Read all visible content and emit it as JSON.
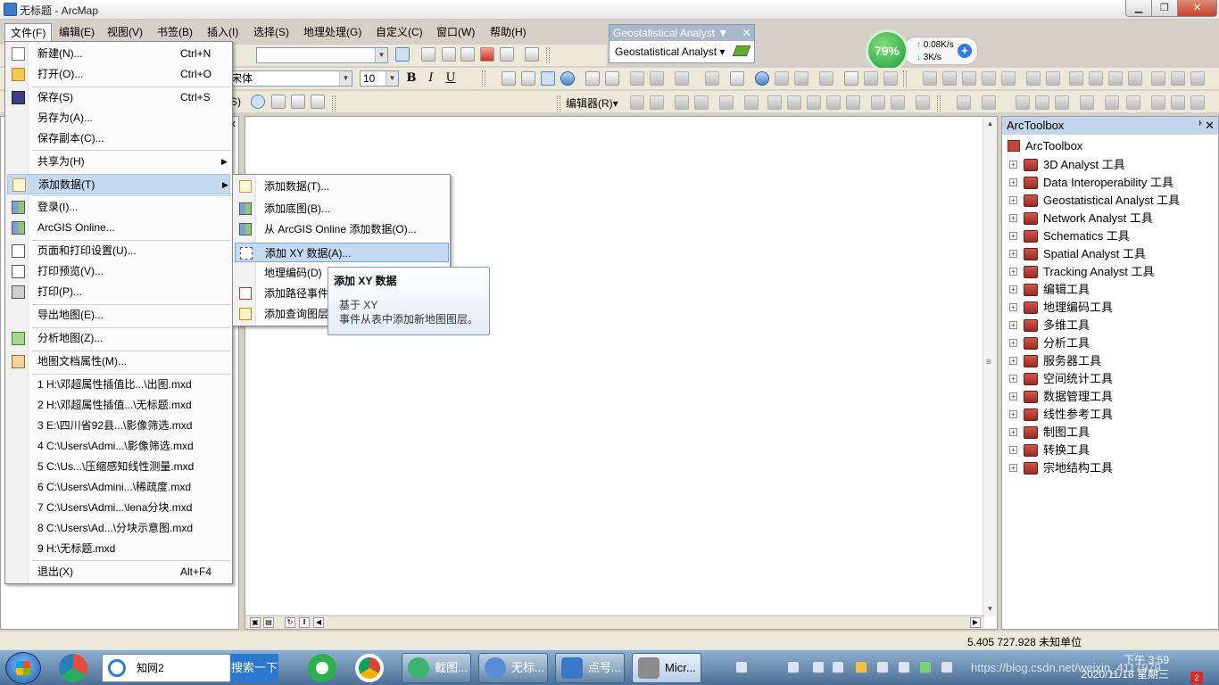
{
  "window": {
    "title": "无标题 - ArcMap"
  },
  "menubar": [
    {
      "id": "file",
      "label": "文件(F)"
    },
    {
      "id": "edit",
      "label": "编辑(E)"
    },
    {
      "id": "view",
      "label": "视图(V)"
    },
    {
      "id": "bookmarks",
      "label": "书签(B)"
    },
    {
      "id": "insert",
      "label": "插入(I)"
    },
    {
      "id": "selection",
      "label": "选择(S)"
    },
    {
      "id": "geoprocessing",
      "label": "地理处理(G)"
    },
    {
      "id": "customize",
      "label": "自定义(C)"
    },
    {
      "id": "windows",
      "label": "窗口(W)"
    },
    {
      "id": "help",
      "label": "帮助(H)"
    }
  ],
  "toolbar": {
    "font_name": "宋体",
    "font_size": "10",
    "bold": "B",
    "italic": "I",
    "underline": "U",
    "editor_label": "编辑器(R)▾",
    "selection_tail": "S)"
  },
  "geostat_toolbar": {
    "title": "Geostatistical Analyst ▼",
    "close": "✕",
    "dropdown": "Geostatistical Analyst ▾"
  },
  "net_speed": {
    "percent": "79%",
    "up": "0.08K/s",
    "down": "3K/s",
    "plus": "+"
  },
  "file_menu": {
    "items": [
      {
        "label": "新建(N)...",
        "shortcut": "Ctrl+N",
        "icon": "new-doc-icon"
      },
      {
        "label": "打开(O)...",
        "shortcut": "Ctrl+O",
        "icon": "open-folder-icon"
      },
      {
        "label": "保存(S)",
        "shortcut": "Ctrl+S",
        "icon": "save-disk-icon"
      },
      {
        "label": "另存为(A)...",
        "shortcut": ""
      },
      {
        "label": "保存副本(C)...",
        "shortcut": ""
      },
      {
        "label": "共享为(H)",
        "shortcut": "",
        "arrow": "▶"
      },
      {
        "label": "添加数据(T)",
        "shortcut": "",
        "arrow": "▶",
        "icon": "add-data-icon"
      },
      {
        "label": "登录(I)...",
        "shortcut": "",
        "icon": "sign-in-icon"
      },
      {
        "label": "ArcGIS Online...",
        "shortcut": "",
        "icon": "arcgis-online-icon"
      },
      {
        "label": "页面和打印设置(U)...",
        "shortcut": "",
        "icon": "page-setup-icon"
      },
      {
        "label": "打印预览(V)...",
        "shortcut": "",
        "icon": "print-preview-icon"
      },
      {
        "label": "打印(P)...",
        "shortcut": "",
        "icon": "printer-icon"
      },
      {
        "label": "导出地图(E)...",
        "shortcut": ""
      },
      {
        "label": "分析地图(Z)...",
        "shortcut": "",
        "icon": "analyze-map-icon"
      },
      {
        "label": "地图文档属性(M)...",
        "shortcut": "",
        "icon": "document-properties-icon"
      },
      {
        "label": "1 H:\\邓超属性插值比...\\出图.mxd",
        "shortcut": ""
      },
      {
        "label": "2 H:\\邓超属性插值...\\无标题.mxd",
        "shortcut": ""
      },
      {
        "label": "3 E:\\四川省92县...\\影像筛选.mxd",
        "shortcut": ""
      },
      {
        "label": "4 C:\\Users\\Admi...\\影像筛选.mxd",
        "shortcut": ""
      },
      {
        "label": "5 C:\\Us...\\压缩感知线性测量.mxd",
        "shortcut": ""
      },
      {
        "label": "6 C:\\Users\\Admini...\\稀疏度.mxd",
        "shortcut": ""
      },
      {
        "label": "7 C:\\Users\\Admi...\\lena分块.mxd",
        "shortcut": ""
      },
      {
        "label": "8 C:\\Users\\Ad...\\分块示意图.mxd",
        "shortcut": ""
      },
      {
        "label": "9 H:\\无标题.mxd",
        "shortcut": ""
      },
      {
        "label": "退出(X)",
        "shortcut": "Alt+F4"
      }
    ]
  },
  "add_data_submenu": {
    "items": [
      {
        "label": "添加数据(T)...",
        "icon": "add-data-icon"
      },
      {
        "label": "添加底图(B)...",
        "icon": "basemap-icon"
      },
      {
        "label": "从 ArcGIS Online 添加数据(O)...",
        "icon": "arcgis-online-icon"
      },
      {
        "label": "添加 XY 数据(A)...",
        "icon": "xy-data-icon"
      },
      {
        "label": "地理编码(D)",
        "icon": ""
      },
      {
        "label": "添加路径事件",
        "icon": "route-event-icon"
      },
      {
        "label": "添加查询图层",
        "icon": "sql-query-icon"
      }
    ]
  },
  "tooltip": {
    "title": "添加 XY 数据",
    "line1": "基于 XY",
    "line2": "事件从表中添加新地图图层。"
  },
  "arctoolbox": {
    "title": "ArcToolbox",
    "pin": "ᅡ",
    "close": "✕",
    "root": "ArcToolbox",
    "items": [
      "3D Analyst 工具",
      "Data Interoperability 工具",
      "Geostatistical Analyst 工具",
      "Network Analyst 工具",
      "Schematics 工具",
      "Spatial Analyst 工具",
      "Tracking Analyst 工具",
      "编辑工具",
      "地理编码工具",
      "多维工具",
      "分析工具",
      "服务器工具",
      "空间统计工具",
      "数据管理工具",
      "线性参考工具",
      "制图工具",
      "转换工具",
      "宗地结构工具"
    ]
  },
  "status": {
    "coords": "5.405  727.928 未知单位"
  },
  "taskbar": {
    "search_text": "知网2",
    "search_button": "搜索一下",
    "tasks": [
      "截图...",
      "无标...",
      "点号...",
      "Micr..."
    ],
    "clock_time": "下午 3:59",
    "clock_date": "2020/11/18 星期三",
    "watermark": "https://blog.csdn.net/weixin_4117979",
    "notif_count": "2"
  }
}
